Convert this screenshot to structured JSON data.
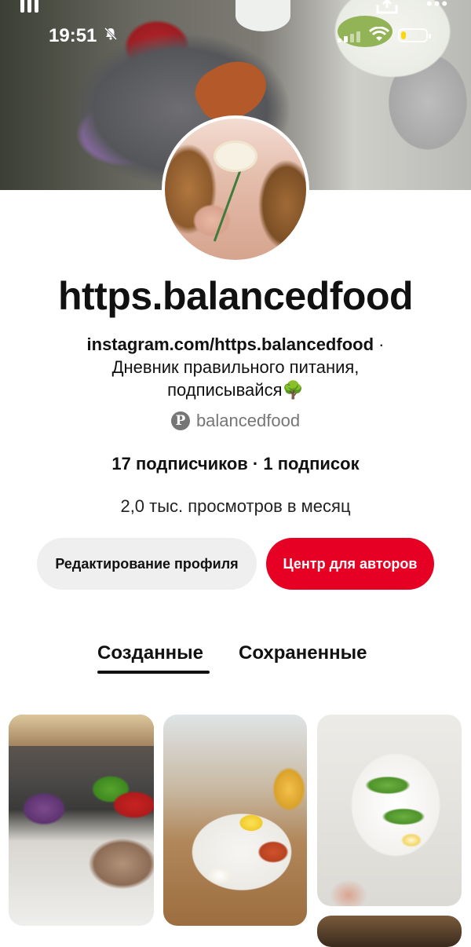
{
  "status_bar": {
    "time": "19:51",
    "battery_level": 0.2,
    "battery_color": "#ffd60a"
  },
  "profile": {
    "display_name": "https.balancedfood",
    "bio_link": "instagram.com/https.balancedfood",
    "bio_separator": " ·",
    "bio_line2": "Дневник правильного питания,",
    "bio_line3": "подписывайся🌳",
    "username": "balancedfood",
    "stats": "17 подписчиков · 1 подписок",
    "monthly_views": "2,0 тыс. просмотров в месяц"
  },
  "buttons": {
    "edit_profile": "Редактирование профиля",
    "creator_hub": "Центр для авторов"
  },
  "tabs": [
    {
      "label": "Созданные",
      "active": true
    },
    {
      "label": "Сохраненные",
      "active": false
    }
  ],
  "colors": {
    "accent": "#e60023",
    "secondary_button": "#efefef",
    "muted_text": "#767676"
  },
  "icons": {
    "pinterest": "pinterest-logo-icon",
    "bell_off": "bell-slash-icon",
    "share": "share-upload-icon",
    "more": "more-dots-icon"
  }
}
